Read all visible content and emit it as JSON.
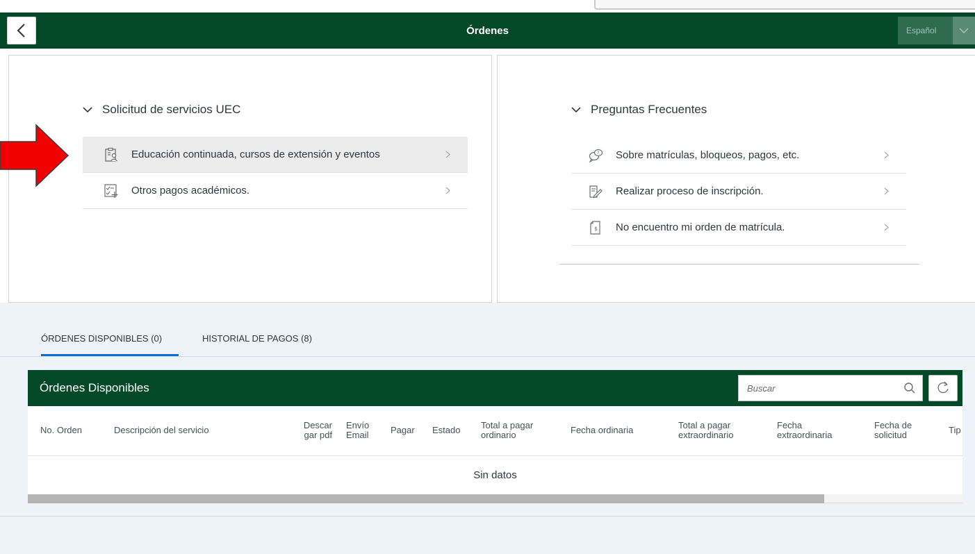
{
  "header": {
    "title": "Órdenes",
    "language": "Español"
  },
  "services": {
    "title": "Solicitud de servicios UEC",
    "items": [
      {
        "label": "Educación continuada, cursos de extensión y eventos",
        "icon": "clipboard-user-icon",
        "selected": true
      },
      {
        "label": "Otros pagos académicos.",
        "icon": "checklist-add-icon",
        "selected": false
      }
    ]
  },
  "faq": {
    "title": "Preguntas Frecuentes",
    "items": [
      {
        "label": "Sobre matrículas, bloqueos, pagos, etc.",
        "icon": "speech-bubbles-icon"
      },
      {
        "label": "Realizar proceso de inscripción.",
        "icon": "edit-document-icon"
      },
      {
        "label": "No encuentro mi orden de matrícula.",
        "icon": "document-dollar-icon"
      }
    ]
  },
  "tabs": [
    {
      "label": "ÓRDENES DISPONIBLES (0)",
      "active": true
    },
    {
      "label": "HISTORIAL DE PAGOS (8)",
      "active": false
    }
  ],
  "table": {
    "title": "Órdenes Disponibles",
    "search_placeholder": "Buscar",
    "columns": [
      {
        "line1": "No. Orden",
        "line2": ""
      },
      {
        "line1": "Descripción del servicio",
        "line2": ""
      },
      {
        "line1": "Descar",
        "line2": "gar pdf"
      },
      {
        "line1": "Envío",
        "line2": "Email"
      },
      {
        "line1": "Pagar",
        "line2": ""
      },
      {
        "line1": "Estado",
        "line2": ""
      },
      {
        "line1": "Total a pagar",
        "line2": "ordinario"
      },
      {
        "line1": "Fecha ordinaria",
        "line2": ""
      },
      {
        "line1": "Total a pagar",
        "line2": "extraordinario"
      },
      {
        "line1": "Fecha",
        "line2": "extraordinaria"
      },
      {
        "line1": "Fecha de",
        "line2": "solicitud"
      },
      {
        "line1": "Tip",
        "line2": ""
      }
    ],
    "empty_text": "Sin datos"
  },
  "colors": {
    "header_green": "#034928",
    "accent_blue": "#0a6ed1",
    "arrow_red": "#f00000"
  }
}
